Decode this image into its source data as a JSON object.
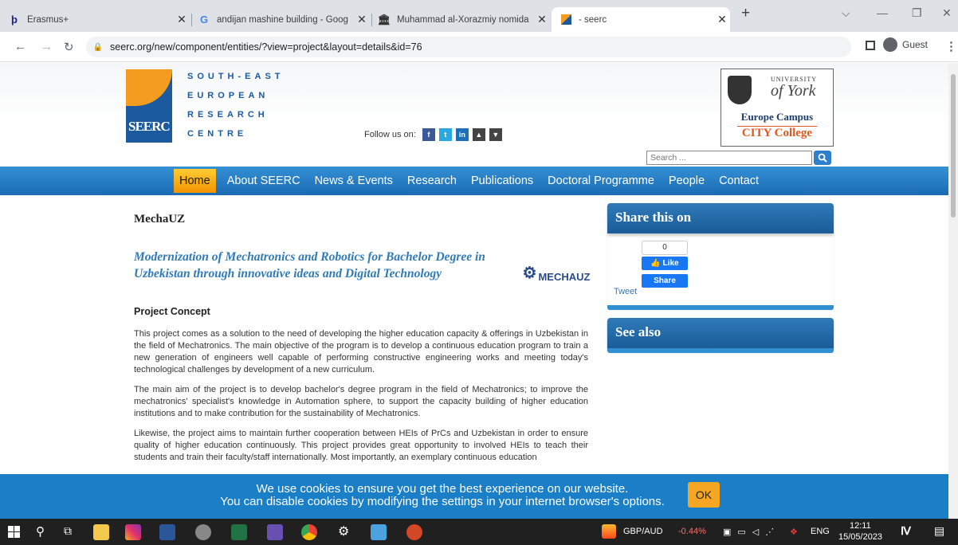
{
  "browser": {
    "tabs": [
      {
        "title": "Erasmus+",
        "favicon": "erasmus-icon"
      },
      {
        "title": "andijan mashine building - Goog",
        "favicon": "google-icon"
      },
      {
        "title": "Muhammad al-Xorazmiy nomida",
        "favicon": "university-icon"
      },
      {
        "title": "- seerc",
        "favicon": "seerc-icon",
        "active": true
      }
    ],
    "url": "seerc.org/new/component/entities/?view=project&layout=details&id=76",
    "profile": "Guest"
  },
  "site": {
    "logo_text": "SEERC",
    "logo_words": [
      "SOUTH-EAST",
      "EUROPEAN",
      "RESEARCH",
      "CENTRE"
    ],
    "follow_label": "Follow us on:",
    "social": [
      {
        "icon": "facebook-icon",
        "glyph": "f",
        "color": "#3b5998"
      },
      {
        "icon": "twitter-icon",
        "glyph": "t",
        "color": "#2aa9e0"
      },
      {
        "icon": "linkedin-icon",
        "glyph": "in",
        "color": "#1d6fb8"
      },
      {
        "icon": "arrow-up-icon",
        "glyph": "▲",
        "color": "#444444"
      },
      {
        "icon": "arrow-down-icon",
        "glyph": "▼",
        "color": "#444444"
      }
    ],
    "york": {
      "university": "UNIVERSITY",
      "of_york": "of York",
      "campus": "Europe Campus",
      "college": "CITY College"
    },
    "search_placeholder": "Search ...",
    "menu": [
      "Home",
      "About SEERC",
      "News & Events",
      "Research",
      "Publications",
      "Doctoral Programme",
      "People",
      "Contact"
    ]
  },
  "article": {
    "title": "MechaUZ",
    "subtitle": "Modernization of Mechatronics and Robotics for Bachelor Degree in Uzbekistan through innovative ideas and Digital Technology",
    "project_logo": "MECHAUZ",
    "section": "Project Concept",
    "paragraphs": [
      "This project comes as a solution to the need of developing the higher education capacity & offerings in Uzbekistan in the field of Mechatronics. The main objective of the program is to develop a continuous education program to train a new generation of engineers well capable of performing constructive engineering works and meeting today's technological challenges by development of a new curriculum.",
      "The main aim of the project is to develop bachelor's degree program in the field of Mechatronics; to improve the mechatronics' specialist's knowledge in Automation sphere, to support the capacity building of higher education institutions and to make contribution for the sustainability of Mechatronics.",
      "Likewise, the project aims to maintain further cooperation between HEIs of PrCs and Uzbekistan in order to ensure quality of higher education continuously. This project provides great opportunity to involved HEIs to teach their students and train their faculty/staff internationally. Most importantly, an exemplary continuous education"
    ]
  },
  "sidebar": {
    "share_title": "Share this on",
    "fb_count": "0",
    "fb_like": "Like",
    "fb_share": "Share",
    "tweet": "Tweet",
    "see_also": "See also"
  },
  "cookie": {
    "line1": "We use cookies to ensure you get the best experience on our website.",
    "line2": "You can disable cookies by modifying the settings in your internet browser's options.",
    "ok": "OK"
  },
  "taskbar": {
    "currency": "GBP/AUD",
    "change": "-0.44%",
    "lang": "ENG",
    "time": "12:11",
    "date": "15/05/2023"
  }
}
